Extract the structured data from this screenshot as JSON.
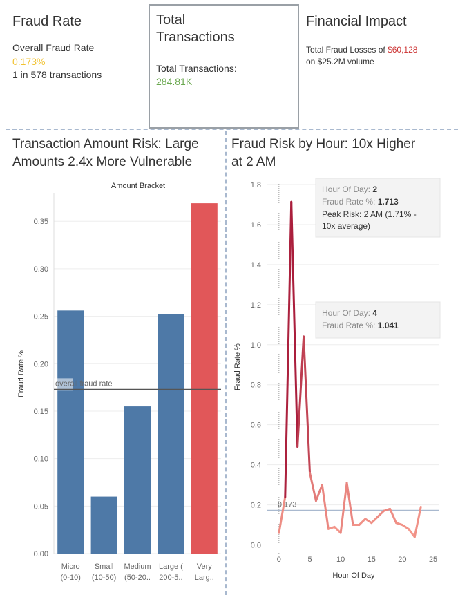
{
  "fraud_rate": {
    "title": "Fraud Rate",
    "label": "Overall Fraud Rate",
    "value": "0.173%",
    "ratio": "1 in 578 transactions",
    "value_color": "#f1c232"
  },
  "total_transactions": {
    "title_line1": "Total",
    "title_line2": "Transactions",
    "label": "Total Transactions:",
    "value": "284.81K",
    "value_color": "#6aa84f"
  },
  "financial_impact": {
    "title": "Financial Impact",
    "line1_prefix": "Total Fraud Losses of ",
    "losses": "$60,128",
    "line2": "on $25.2M volume",
    "losses_color": "#cc3333"
  },
  "chart_data": [
    {
      "type": "bar",
      "title_line1": "Transaction Amount Risk: Large",
      "title_line2": "Amounts 2.4x More Vulnerable",
      "header": "Amount Bracket",
      "ylabel": "Fraud Rate %",
      "ylim": [
        0,
        0.38
      ],
      "yticks": [
        "0.00",
        "0.05",
        "0.10",
        "0.15",
        "0.20",
        "0.25",
        "0.30",
        "0.35"
      ],
      "categories": [
        {
          "line1": "Micro",
          "line2": "(0-10)"
        },
        {
          "line1": "Small",
          "line2": "(10-50)"
        },
        {
          "line1": "Medium",
          "line2": "(50-20.."
        },
        {
          "line1": "Large (",
          "line2": "200-5.."
        },
        {
          "line1": "Very",
          "line2": "Larg.."
        }
      ],
      "values": [
        0.256,
        0.06,
        0.155,
        0.252,
        0.369
      ],
      "colors": [
        "#4e79a7",
        "#4e79a7",
        "#4e79a7",
        "#4e79a7",
        "#e15759"
      ],
      "reference_line": {
        "value": 0.173,
        "label": "overall fraud rate"
      }
    },
    {
      "type": "line",
      "title_line1": "Fraud Risk by Hour: 10x Higher",
      "title_line2": "at 2 AM",
      "xlabel": "Hour Of Day",
      "ylabel": "Fraud Rate %",
      "xlim": [
        -2,
        26
      ],
      "ylim": [
        -0.05,
        1.8
      ],
      "xticks": [
        "0",
        "5",
        "10",
        "15",
        "20",
        "25"
      ],
      "yticks": [
        "0.0",
        "0.2",
        "0.4",
        "0.6",
        "0.8",
        "1.0",
        "1.2",
        "1.4",
        "1.6",
        "1.8"
      ],
      "x": [
        0,
        1,
        2,
        3,
        4,
        5,
        6,
        7,
        8,
        9,
        10,
        11,
        12,
        13,
        14,
        15,
        16,
        17,
        18,
        19,
        20,
        21,
        22,
        23
      ],
      "y": [
        0.06,
        0.24,
        1.713,
        0.49,
        1.041,
        0.36,
        0.22,
        0.3,
        0.08,
        0.09,
        0.06,
        0.31,
        0.1,
        0.1,
        0.13,
        0.11,
        0.14,
        0.17,
        0.18,
        0.11,
        0.1,
        0.08,
        0.04,
        0.19
      ],
      "reference_line": {
        "value": 0.173,
        "label": "0.173"
      },
      "tooltips": [
        {
          "hour_label": "Hour Of Day:",
          "hour_value": "2",
          "rate_label": "Fraud Rate %:",
          "rate_value": "1.713",
          "extra1": "Peak Risk: 2 AM (1.71% -",
          "extra2": "10x average)"
        },
        {
          "hour_label": "Hour Of Day:",
          "hour_value": "4",
          "rate_label": "Fraud Rate %:",
          "rate_value": "1.041"
        }
      ]
    }
  ]
}
